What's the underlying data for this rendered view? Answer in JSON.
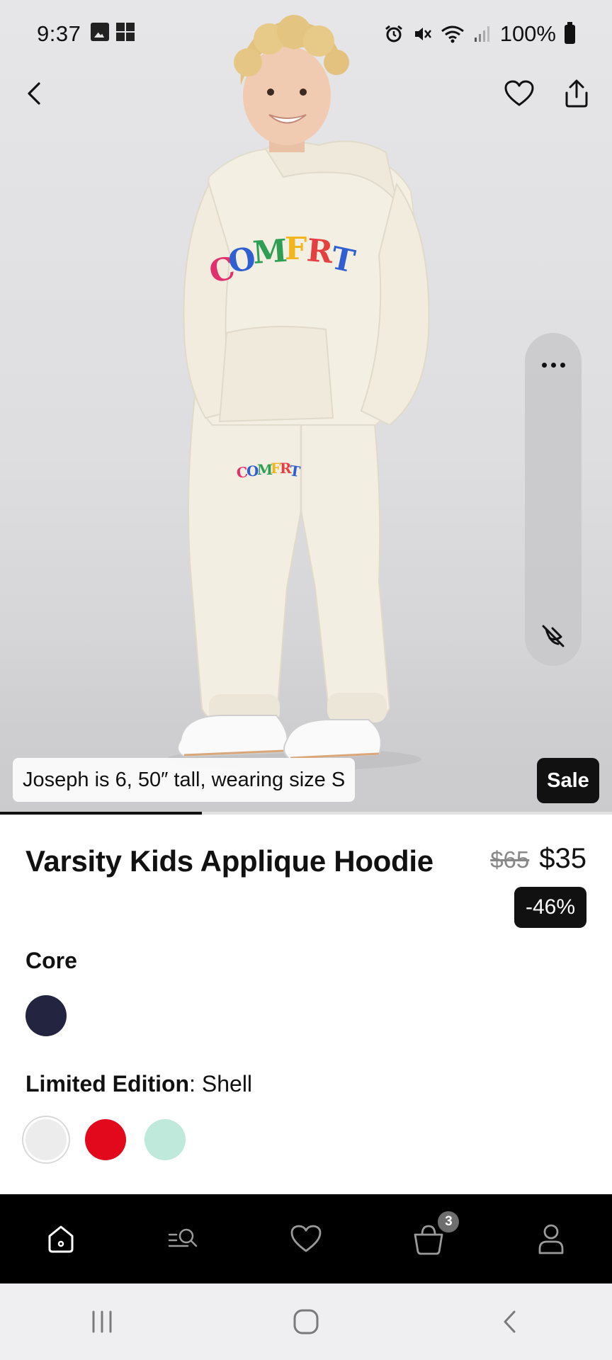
{
  "status_bar": {
    "time": "9:37",
    "battery": "100%",
    "icons": [
      "gallery-icon",
      "app-grid-icon",
      "alarm-icon",
      "mute-icon",
      "wifi-icon",
      "signal-icon",
      "battery-icon"
    ]
  },
  "hero": {
    "caption": "Joseph is 6, 50″ tall, wearing size S",
    "badge": "Sale",
    "gallery_progress": 0.33,
    "hoodie_print": "COMFRT"
  },
  "product": {
    "title": "Varsity Kids Applique Hoodie",
    "original_price": "$65",
    "sale_price": "$35",
    "discount": "-46%"
  },
  "colors": {
    "core_label": "Core",
    "core_swatches": [
      {
        "name": "Navy",
        "hex": "#23243f"
      }
    ],
    "limited_label": "Limited Edition",
    "limited_selected": "Shell",
    "limited_swatches": [
      {
        "name": "Shell",
        "hex": "#ececec",
        "selected": true
      },
      {
        "name": "Red",
        "hex": "#e3091d"
      },
      {
        "name": "Mint",
        "hex": "#bfe9db"
      }
    ]
  },
  "tabbar": {
    "items": [
      "home-icon",
      "search-menu-icon",
      "heart-icon",
      "cart-icon",
      "account-icon"
    ],
    "cart_count": "3"
  },
  "theme": {
    "dark": "#111111",
    "hoodie": "#f4efe3"
  }
}
